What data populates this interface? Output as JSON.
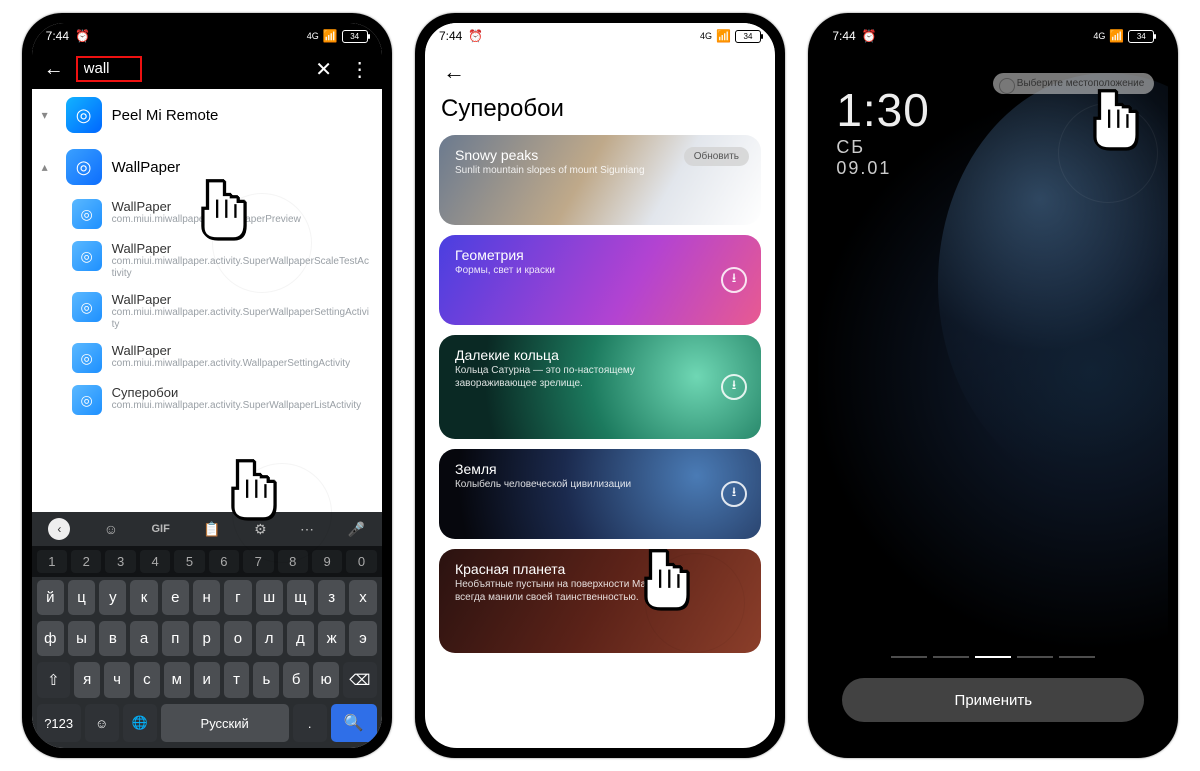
{
  "status": {
    "time": "7:44",
    "battery": "34",
    "signal": "4G"
  },
  "s1": {
    "search_value": "wall",
    "apps": {
      "peel": "Peel Mi Remote",
      "wallpaper": "WallPaper"
    },
    "activities": [
      {
        "t": "WallPaper",
        "s": "com.miui.miwallpaper.MiWallpaperPreview"
      },
      {
        "t": "WallPaper",
        "s": "com.miui.miwallpaper.activity.SuperWallpaperScaleTestActivity"
      },
      {
        "t": "WallPaper",
        "s": "com.miui.miwallpaper.activity.SuperWallpaperSettingActivity"
      },
      {
        "t": "WallPaper",
        "s": "com.miui.miwallpaper.activity.WallpaperSettingActivity"
      },
      {
        "t": "Суперобои",
        "s": "com.miui.miwallpaper.activity.SuperWallpaperListActivity"
      }
    ],
    "kb": {
      "nums": [
        "1",
        "2",
        "3",
        "4",
        "5",
        "6",
        "7",
        "8",
        "9",
        "0"
      ],
      "r1": [
        "й",
        "ц",
        "у",
        "к",
        "е",
        "н",
        "г",
        "ш",
        "щ",
        "з",
        "х"
      ],
      "r2": [
        "ф",
        "ы",
        "в",
        "а",
        "п",
        "р",
        "о",
        "л",
        "д",
        "ж",
        "э"
      ],
      "r3": [
        "я",
        "ч",
        "с",
        "м",
        "и",
        "т",
        "ь",
        "б",
        "ю"
      ],
      "sym": "?123",
      "lang": "Русский",
      "gif": "GIF"
    }
  },
  "s2": {
    "title": "Суперобои",
    "cards": [
      {
        "t": "Snowy peaks",
        "s": "Sunlit mountain slopes of mount Siguniang",
        "pill": "Обновить"
      },
      {
        "t": "Геометрия",
        "s": "Формы, свет и краски",
        "dl": true
      },
      {
        "t": "Далекие кольца",
        "s": "Кольца Сатурна — это по-настоящему завораживающее зрелище.",
        "dl": true
      },
      {
        "t": "Земля",
        "s": "Колыбель человеческой цивилизации",
        "dl": true
      },
      {
        "t": "Красная планета",
        "s": "Необъятные пустыни на поверхности Марса всегда манили своей таинственностью."
      }
    ]
  },
  "s3": {
    "time": "1:30",
    "day": "СБ",
    "date": "09.01",
    "loc": "Выберите местоположение",
    "apply": "Применить"
  }
}
